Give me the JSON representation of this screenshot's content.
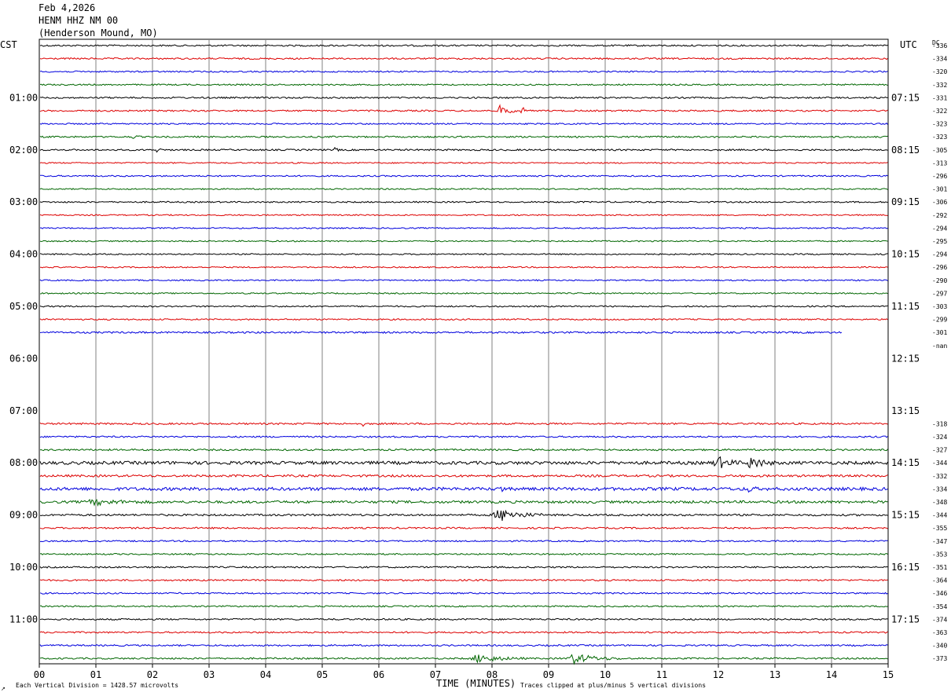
{
  "header": {
    "date": "Feb 4,2026",
    "station": "HENM HHZ NM 00",
    "location": "(Henderson Mound, MO)"
  },
  "labels": {
    "left_zone": "CST",
    "right_zone": "UTC",
    "dc": "DC",
    "x_axis": "TIME (MINUTES)",
    "scale_note": "Each Vertical Division = 1428.57 microvolts",
    "clip_note": "Traces clipped at plus/minus 5 vertical divisions",
    "corner_mark": "↗"
  },
  "chart_data": {
    "type": "line",
    "title": "HENM HHZ NM 00",
    "xlabel": "TIME (MINUTES)",
    "x_ticks": [
      "00",
      "01",
      "02",
      "03",
      "04",
      "05",
      "06",
      "07",
      "08",
      "09",
      "10",
      "11",
      "12",
      "13",
      "14",
      "15"
    ],
    "xlim": [
      0,
      15
    ],
    "trace_colors": [
      "#000000",
      "#dd0000",
      "#0000dd",
      "#006600"
    ],
    "left_hour_labels": [
      {
        "row": 4,
        "text": "01:00"
      },
      {
        "row": 8,
        "text": "02:00"
      },
      {
        "row": 12,
        "text": "03:00"
      },
      {
        "row": 16,
        "text": "04:00"
      },
      {
        "row": 20,
        "text": "05:00"
      },
      {
        "row": 24,
        "text": "06:00"
      },
      {
        "row": 28,
        "text": "07:00"
      },
      {
        "row": 32,
        "text": "08:00"
      },
      {
        "row": 36,
        "text": "09:00"
      },
      {
        "row": 40,
        "text": "10:00"
      },
      {
        "row": 44,
        "text": "11:00"
      }
    ],
    "right_hour_labels": [
      {
        "row": 4,
        "text": "07:15"
      },
      {
        "row": 8,
        "text": "08:15"
      },
      {
        "row": 12,
        "text": "09:15"
      },
      {
        "row": 16,
        "text": "10:15"
      },
      {
        "row": 20,
        "text": "11:15"
      },
      {
        "row": 24,
        "text": "12:15"
      },
      {
        "row": 28,
        "text": "13:15"
      },
      {
        "row": 32,
        "text": "14:15"
      },
      {
        "row": 36,
        "text": "15:15"
      },
      {
        "row": 40,
        "text": "16:15"
      },
      {
        "row": 44,
        "text": "17:15"
      }
    ],
    "rows": [
      {
        "dc": "-336",
        "amp": 1.0,
        "end": 15
      },
      {
        "dc": "-334",
        "amp": 1.0,
        "end": 15
      },
      {
        "dc": "-320",
        "amp": 0.9,
        "end": 15
      },
      {
        "dc": "-332",
        "amp": 0.9,
        "end": 15
      },
      {
        "dc": "-331",
        "amp": 1.0,
        "end": 15
      },
      {
        "dc": "-322",
        "amp": 1.0,
        "end": 15,
        "events": [
          {
            "t": 8.1,
            "dur": 0.35,
            "amp": 8
          },
          {
            "t": 8.5,
            "dur": 0.1,
            "amp": 10
          }
        ]
      },
      {
        "dc": "-323",
        "amp": 0.9,
        "end": 15
      },
      {
        "dc": "-323",
        "amp": 1.0,
        "end": 15,
        "events": [
          {
            "t": 1.6,
            "dur": 0.2,
            "amp": 2.5
          }
        ]
      },
      {
        "dc": "-305",
        "amp": 1.0,
        "end": 15,
        "events": [
          {
            "t": 2.05,
            "dur": 0.15,
            "amp": 2.5
          },
          {
            "t": 5.2,
            "dur": 0.15,
            "amp": 2
          }
        ]
      },
      {
        "dc": "-313",
        "amp": 0.8,
        "end": 15
      },
      {
        "dc": "-296",
        "amp": 0.9,
        "end": 15
      },
      {
        "dc": "-301",
        "amp": 0.8,
        "end": 15
      },
      {
        "dc": "-306",
        "amp": 0.9,
        "end": 15
      },
      {
        "dc": "-292",
        "amp": 0.8,
        "end": 15
      },
      {
        "dc": "-294",
        "amp": 0.8,
        "end": 15
      },
      {
        "dc": "-295",
        "amp": 0.8,
        "end": 15
      },
      {
        "dc": "-294",
        "amp": 0.8,
        "end": 15
      },
      {
        "dc": "-296",
        "amp": 0.8,
        "end": 15
      },
      {
        "dc": "-290",
        "amp": 0.8,
        "end": 15
      },
      {
        "dc": "-297",
        "amp": 0.8,
        "end": 15
      },
      {
        "dc": "-303",
        "amp": 0.9,
        "end": 15
      },
      {
        "dc": "-299",
        "amp": 0.9,
        "end": 15
      },
      {
        "dc": "-301",
        "amp": 1.1,
        "end": 14.2
      },
      {
        "dc": "-nan",
        "amp": 0,
        "end": 0
      },
      {
        "dc": "",
        "amp": 0,
        "end": 0
      },
      {
        "dc": "",
        "amp": 0,
        "end": 0
      },
      {
        "dc": "",
        "amp": 0,
        "end": 0
      },
      {
        "dc": "",
        "amp": 0,
        "end": 0
      },
      {
        "dc": "",
        "amp": 0,
        "end": 0
      },
      {
        "dc": "-318",
        "amp": 1.1,
        "end": 15,
        "events": [
          {
            "t": 5.7,
            "dur": 0.1,
            "amp": 2.5
          }
        ]
      },
      {
        "dc": "-324",
        "amp": 1.0,
        "end": 15
      },
      {
        "dc": "-327",
        "amp": 1.1,
        "end": 15
      },
      {
        "dc": "-344",
        "amp": 2.0,
        "end": 15,
        "events": [
          {
            "t": 11.9,
            "dur": 0.5,
            "amp": 8
          },
          {
            "t": 12.5,
            "dur": 0.5,
            "amp": 8
          }
        ]
      },
      {
        "dc": "-332",
        "amp": 1.4,
        "end": 15
      },
      {
        "dc": "-334",
        "amp": 2.0,
        "end": 15,
        "events": [
          {
            "t": 8.15,
            "dur": 0.1,
            "amp": 5
          },
          {
            "t": 12.5,
            "dur": 0.2,
            "amp": 4
          }
        ]
      },
      {
        "dc": "-348",
        "amp": 1.6,
        "end": 15,
        "events": [
          {
            "t": 0.8,
            "dur": 1.2,
            "amp": 3
          }
        ]
      },
      {
        "dc": "-344",
        "amp": 1.2,
        "end": 15,
        "events": [
          {
            "t": 8.0,
            "dur": 0.9,
            "amp": 8
          }
        ]
      },
      {
        "dc": "-355",
        "amp": 1.0,
        "end": 15
      },
      {
        "dc": "-347",
        "amp": 0.9,
        "end": 15
      },
      {
        "dc": "-353",
        "amp": 0.9,
        "end": 15
      },
      {
        "dc": "-351",
        "amp": 1.0,
        "end": 15
      },
      {
        "dc": "-364",
        "amp": 1.0,
        "end": 15
      },
      {
        "dc": "-346",
        "amp": 0.9,
        "end": 15
      },
      {
        "dc": "-354",
        "amp": 0.9,
        "end": 15,
        "events": [
          {
            "t": 0.6,
            "dur": 0.1,
            "amp": 2.5
          }
        ]
      },
      {
        "dc": "-374",
        "amp": 1.0,
        "end": 15
      },
      {
        "dc": "-363",
        "amp": 1.0,
        "end": 15
      },
      {
        "dc": "-340",
        "amp": 1.0,
        "end": 15
      },
      {
        "dc": "-373",
        "amp": 1.0,
        "end": 15,
        "events": [
          {
            "t": 7.6,
            "dur": 1.0,
            "amp": 5
          },
          {
            "t": 9.3,
            "dur": 1.0,
            "amp": 6
          }
        ]
      }
    ]
  }
}
